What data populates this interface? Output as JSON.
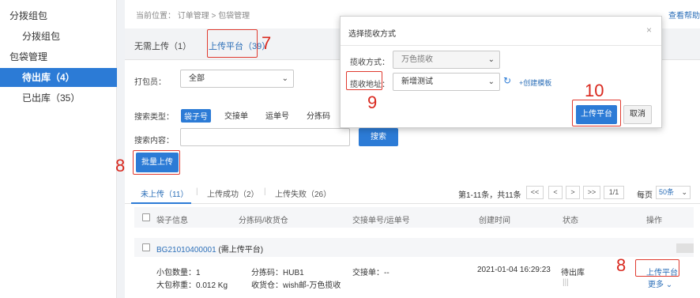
{
  "sidebar": {
    "items": [
      {
        "label": "分拨组包"
      },
      {
        "label": "分拨组包"
      },
      {
        "label": "包袋管理"
      },
      {
        "label": "待出库（4）"
      },
      {
        "label": "已出库（35）"
      }
    ]
  },
  "header": {
    "breadcrumb": "当前位置： 订单管理 > 包袋管理",
    "help": "查看帮助"
  },
  "tabs": [
    {
      "label": "无需上传（1）"
    },
    {
      "label": "上传平台（39）"
    }
  ],
  "filters": {
    "packer_label": "打包员：",
    "packer_value": "全部",
    "search_type_label": "搜索类型：",
    "search_types": [
      "袋子号",
      "交接单",
      "运单号",
      "分拣码"
    ],
    "search_content_label": "搜索内容：",
    "search_button": "搜索",
    "batch_upload_button": "批量上传"
  },
  "sub_tabs": [
    {
      "label": "未上传（11）"
    },
    {
      "label": "上传成功（2）"
    },
    {
      "label": "上传失败（26）"
    }
  ],
  "pagination": {
    "info": "第1-11条，共11条",
    "first": "<<",
    "prev": "<",
    "next": ">",
    "last": ">>",
    "page": "1/1",
    "per_page_label": "每页",
    "per_page_value": "50条"
  },
  "table": {
    "headers": [
      "袋子信息",
      "分拣码/收货仓",
      "交接单号/运单号",
      "创建时间",
      "状态",
      "操作"
    ],
    "group": {
      "id": "BG21010400001",
      "note": "(需上传平台)"
    },
    "row": {
      "small_count": "小包数量：1",
      "weight": "大包称重：0.012 Kg",
      "sort_code": "分拣码：HUB1",
      "warehouse": "收货仓：wish邮-万色揽收",
      "handover": "交接单：--",
      "created": "2021-01-04 16:29:23",
      "status": "待出库",
      "action_upload": "上传平台",
      "action_more": "更多"
    }
  },
  "modal": {
    "title": "选择揽收方式",
    "method_label": "揽收方式：",
    "method_value": "万色揽收",
    "address_label": "揽收地址：",
    "address_value": "新增测试",
    "create_template": "+创建模板",
    "upload_button": "上传平台",
    "cancel_button": "取消"
  },
  "annotations": [
    "7",
    "8",
    "8",
    "9",
    "10"
  ],
  "colors": {
    "accent": "#2c7bd6",
    "highlight": "#e03a2f"
  }
}
